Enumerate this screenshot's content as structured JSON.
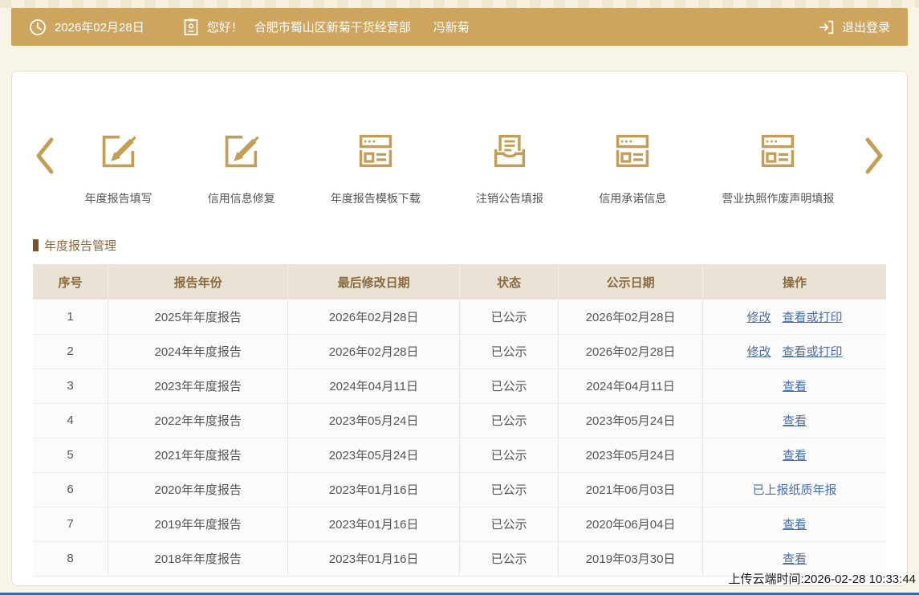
{
  "header": {
    "date": "2026年02月28日",
    "greeting": "您好！",
    "company": "合肥市蜀山区新菊干货经营部",
    "user": "冯新菊",
    "logout_label": "退出登录"
  },
  "nav": {
    "items": [
      {
        "label": "年度报告填写",
        "icon": "edit-square-icon"
      },
      {
        "label": "信用信息修复",
        "icon": "edit-square-icon"
      },
      {
        "label": "年度报告模板下载",
        "icon": "browser-window-icon"
      },
      {
        "label": "注销公告填报",
        "icon": "inbox-document-icon"
      },
      {
        "label": "信用承诺信息",
        "icon": "browser-window-icon"
      },
      {
        "label": "营业执照作废声明填报",
        "icon": "browser-window-icon"
      }
    ]
  },
  "section": {
    "title": "年度报告管理"
  },
  "table": {
    "columns": [
      "序号",
      "报告年份",
      "最后修改日期",
      "状态",
      "公示日期",
      "操作"
    ],
    "rows": [
      {
        "seq": "1",
        "year": "2025年年度报告",
        "modified": "2026年02月28日",
        "status": "已公示",
        "published": "2026年02月28日",
        "actions": [
          {
            "label": "修改",
            "underline": true
          },
          {
            "label": "查看或打印",
            "underline": true
          }
        ]
      },
      {
        "seq": "2",
        "year": "2024年年度报告",
        "modified": "2026年02月28日",
        "status": "已公示",
        "published": "2026年02月28日",
        "actions": [
          {
            "label": "修改",
            "underline": true
          },
          {
            "label": "查看或打印",
            "underline": true
          }
        ]
      },
      {
        "seq": "3",
        "year": "2023年年度报告",
        "modified": "2024年04月11日",
        "status": "已公示",
        "published": "2024年04月11日",
        "actions": [
          {
            "label": "查看",
            "underline": true
          }
        ]
      },
      {
        "seq": "4",
        "year": "2022年年度报告",
        "modified": "2023年05月24日",
        "status": "已公示",
        "published": "2023年05月24日",
        "actions": [
          {
            "label": "查看",
            "underline": true
          }
        ]
      },
      {
        "seq": "5",
        "year": "2021年年度报告",
        "modified": "2023年05月24日",
        "status": "已公示",
        "published": "2023年05月24日",
        "actions": [
          {
            "label": "查看",
            "underline": true
          }
        ]
      },
      {
        "seq": "6",
        "year": "2020年年度报告",
        "modified": "2023年01月16日",
        "status": "已公示",
        "published": "2021年06月03日",
        "actions": [
          {
            "label": "已上报纸质年报",
            "underline": false
          }
        ]
      },
      {
        "seq": "7",
        "year": "2019年年度报告",
        "modified": "2023年01月16日",
        "status": "已公示",
        "published": "2020年06月04日",
        "actions": [
          {
            "label": "查看",
            "underline": true
          }
        ]
      },
      {
        "seq": "8",
        "year": "2018年年度报告",
        "modified": "2023年01月16日",
        "status": "已公示",
        "published": "2019年03月30日",
        "actions": [
          {
            "label": "查看",
            "underline": true
          }
        ]
      }
    ]
  },
  "footer": {
    "upload_time": "上传云端时间:2026-02-28 10:33:44"
  },
  "colors": {
    "gold": "#cda55e",
    "gold_icon": "#c49e55",
    "bg": "#f8f4e7",
    "card": "#ffffff",
    "table_header_bg": "#eae2d4",
    "brown": "#8a6a3f",
    "marker": "#7a5426",
    "link": "#4a6fad",
    "text": "#555555",
    "border": "#e7e7e7",
    "footer_blue": "#3f699e",
    "timestamp": "#1a1a1a"
  }
}
